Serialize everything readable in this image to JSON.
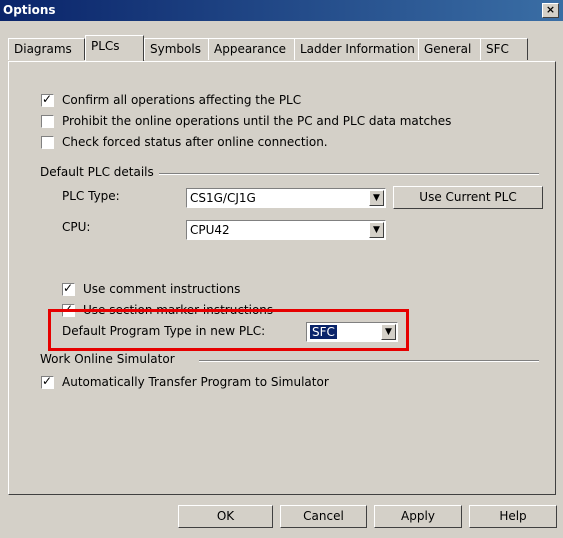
{
  "window": {
    "title": "Options",
    "close_label": "×"
  },
  "tabs": [
    {
      "label": "Diagrams"
    },
    {
      "label": "PLCs"
    },
    {
      "label": "Symbols"
    },
    {
      "label": "Appearance"
    },
    {
      "label": "Ladder Information"
    },
    {
      "label": "General"
    },
    {
      "label": "SFC"
    }
  ],
  "checks": {
    "confirm": "Confirm all operations affecting the PLC",
    "prohibit": "Prohibit the online operations until the PC and PLC data matches",
    "forced": "Check forced status after online connection.",
    "comment": "Use comment instructions",
    "section": "Use section marker instructions",
    "transfer": "Automatically Transfer Program to Simulator"
  },
  "default_plc": {
    "group_label": "Default PLC details",
    "plc_type_label": "PLC Type:",
    "plc_type_value": "CS1G/CJ1G",
    "use_current_label": "Use Current PLC",
    "cpu_label": "CPU:",
    "cpu_value": "CPU42",
    "program_type_label": "Default Program Type in new PLC:",
    "program_type_value": "SFC"
  },
  "simulator": {
    "group_label": "Work Online Simulator"
  },
  "buttons": {
    "ok": "OK",
    "cancel": "Cancel",
    "apply": "Apply",
    "help": "Help"
  },
  "colors": {
    "title_bar": "#0a246a",
    "highlight_box": "#e60000",
    "face": "#d4d0c8"
  }
}
